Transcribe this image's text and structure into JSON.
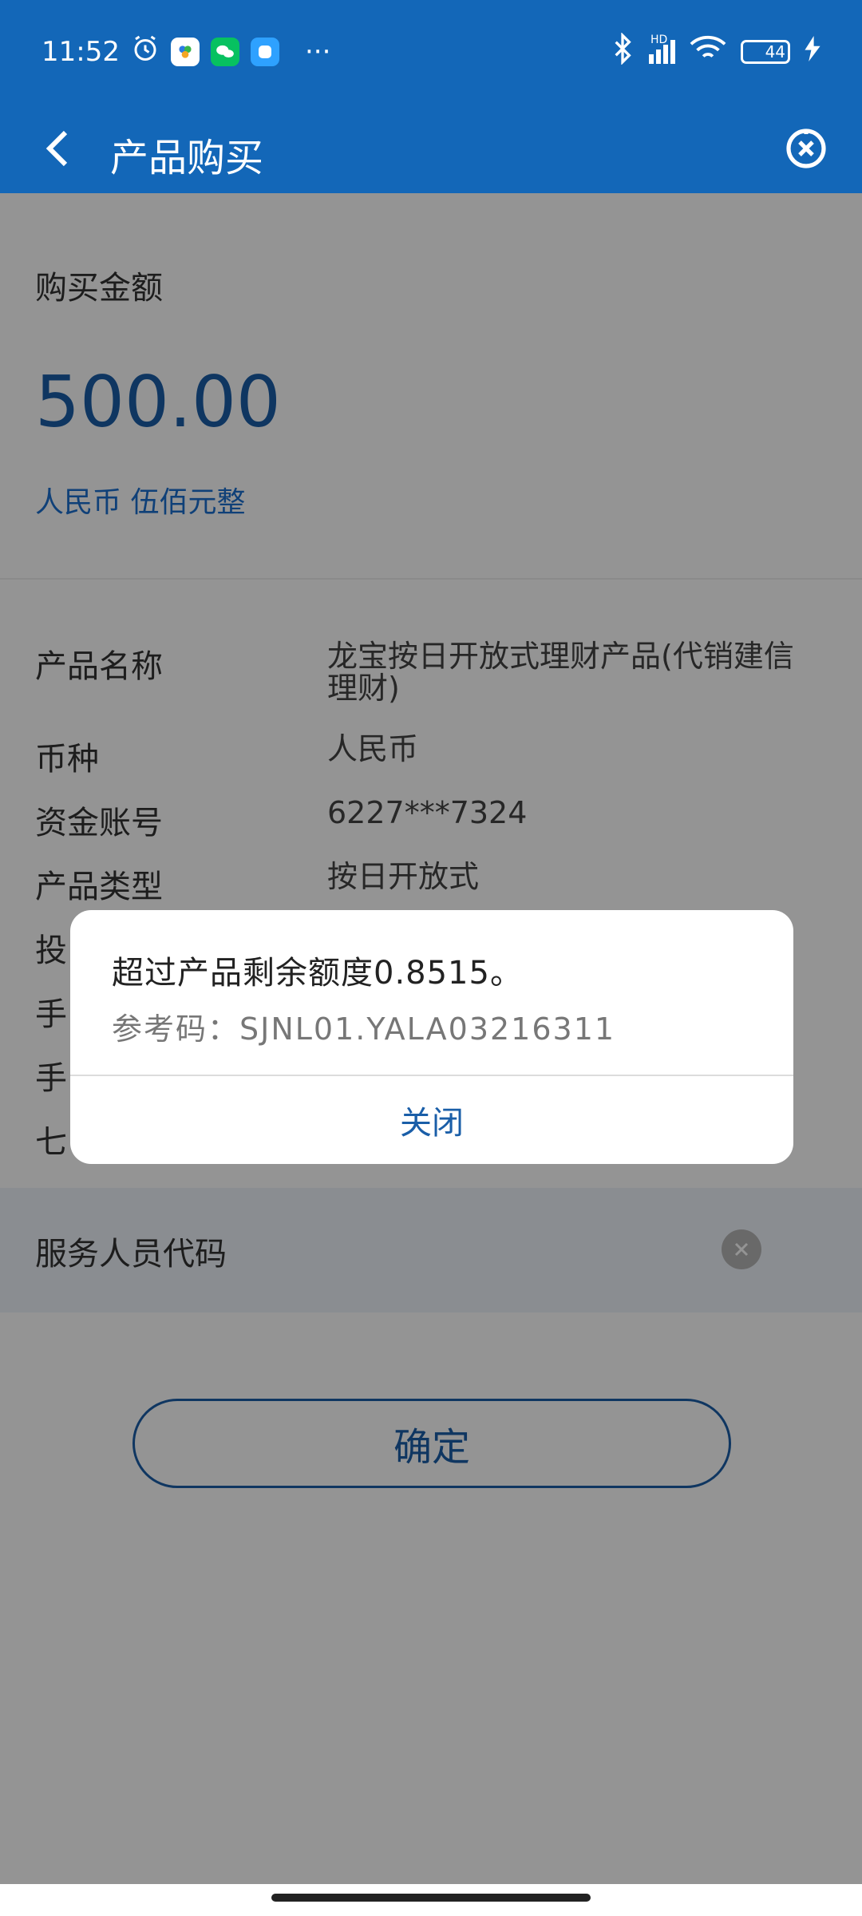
{
  "status_bar": {
    "time": "11:52",
    "overflow": "···",
    "hd_label": "HD",
    "battery": "44",
    "battery_level": 0.44
  },
  "nav": {
    "title": "产品购买"
  },
  "amount": {
    "label": "购买金额",
    "value": "500.00",
    "words": "人民币 伍佰元整"
  },
  "details": [
    {
      "label": "产品名称",
      "value": "龙宝按日开放式理财产品(代销建信理财)"
    },
    {
      "label": "币种",
      "value": "人民币"
    },
    {
      "label": "资金账号",
      "value": "6227***7324"
    },
    {
      "label": "产品类型",
      "value": "按日开放式"
    },
    {
      "label": "投",
      "value": ""
    },
    {
      "label": "手",
      "value": ""
    },
    {
      "label": "手",
      "value": ""
    },
    {
      "label": "七",
      "value": ""
    }
  ],
  "service": {
    "label": "服务人员代码"
  },
  "confirm": {
    "label": "确定"
  },
  "dialog": {
    "message": "超过产品剩余额度0.8515。",
    "ref": "参考码：SJNL01.YALA03216311",
    "close_label": "关闭"
  },
  "colors": {
    "primary": "#1367b8",
    "accent_text": "#1a5ea8",
    "overlay": "rgba(0,0,0,0.42)"
  }
}
